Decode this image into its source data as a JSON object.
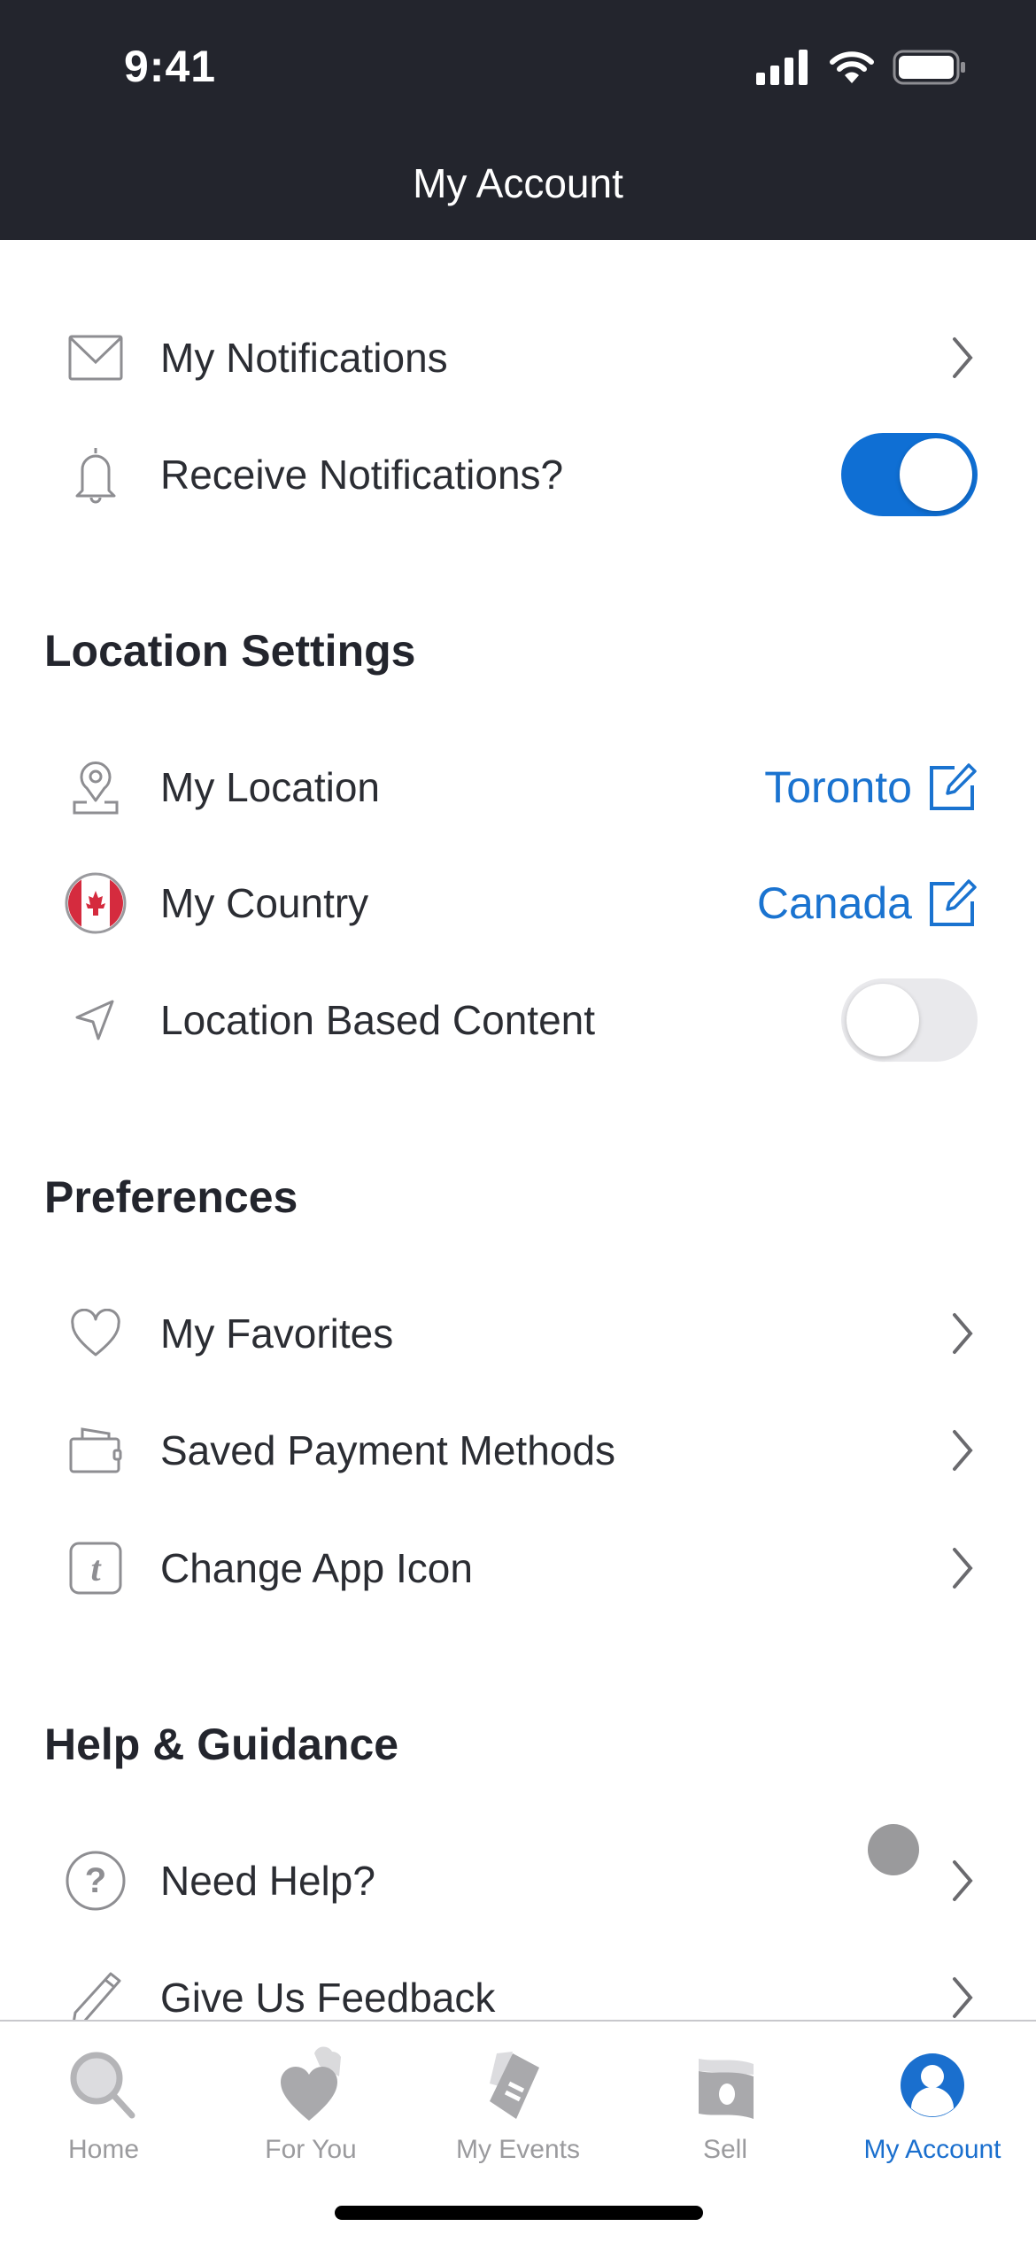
{
  "status_bar": {
    "time": "9:41"
  },
  "header": {
    "title": "My Account"
  },
  "notifications": {
    "items": [
      {
        "label": "My Notifications",
        "icon": "envelope-icon",
        "trailing": "chevron"
      },
      {
        "label": "Receive Notifications?",
        "icon": "bell-icon",
        "trailing": "toggle",
        "toggle_on": true
      }
    ]
  },
  "location_settings": {
    "title": "Location Settings",
    "items": [
      {
        "label": "My Location",
        "icon": "location-pin-icon",
        "value": "Toronto"
      },
      {
        "label": "My Country",
        "icon": "canada-flag-icon",
        "value": "Canada"
      },
      {
        "label": "Location Based Content",
        "icon": "navigation-arrow-icon",
        "trailing": "toggle",
        "toggle_on": false
      }
    ]
  },
  "preferences": {
    "title": "Preferences",
    "items": [
      {
        "label": "My Favorites",
        "icon": "heart-icon"
      },
      {
        "label": "Saved Payment Methods",
        "icon": "wallet-icon"
      },
      {
        "label": "Change App Icon",
        "icon": "app-icon-t-icon",
        "glyph": "t"
      }
    ]
  },
  "help": {
    "title": "Help & Guidance",
    "items": [
      {
        "label": "Need Help?",
        "icon": "question-circle-icon",
        "glyph": "?"
      },
      {
        "label": "Give Us Feedback",
        "icon": "pencil-icon"
      }
    ]
  },
  "tabbar": {
    "active": "My Account",
    "tabs": [
      {
        "label": "Home",
        "icon": "search-icon"
      },
      {
        "label": "For You",
        "icon": "hearts-icon"
      },
      {
        "label": "My Events",
        "icon": "tickets-icon"
      },
      {
        "label": "Sell",
        "icon": "money-icon"
      },
      {
        "label": "My Account",
        "icon": "account-icon"
      }
    ]
  },
  "colors": {
    "header_bg": "#23252d",
    "accent": "#1a73d0",
    "toggle_on": "#0f6fd4",
    "toggle_off": "#e9e9ec",
    "icon_gray": "#9b9b9e"
  }
}
